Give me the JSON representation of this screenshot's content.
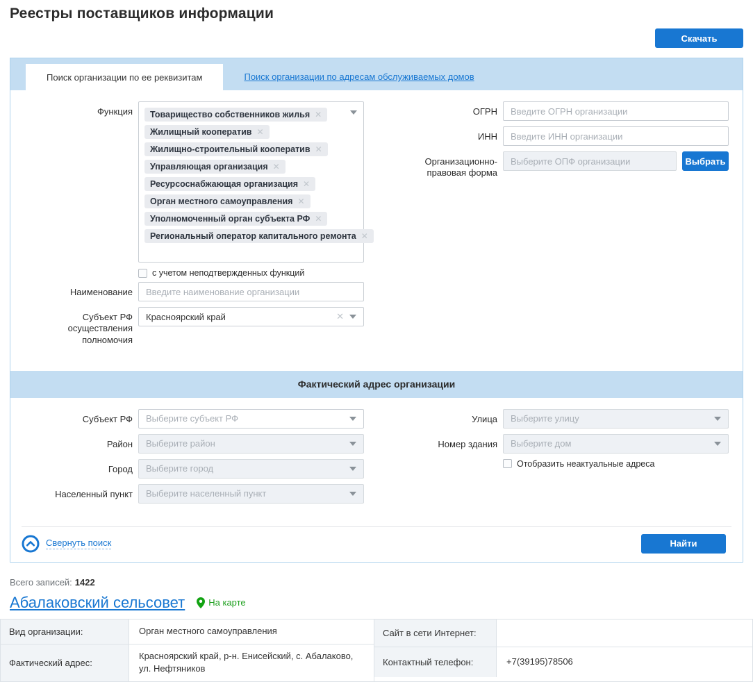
{
  "page": {
    "title": "Реестры поставщиков информации",
    "download_button": "Скачать"
  },
  "tabs": [
    {
      "label": "Поиск организации по ее реквизитам",
      "active": true
    },
    {
      "label": "Поиск организации по адресам обслуживаемых домов",
      "active": false
    }
  ],
  "search_form": {
    "function": {
      "label": "Функция",
      "tags": [
        "Товарищество собственников жилья",
        "Жилищный кооператив",
        "Жилищно-строительный кооператив",
        "Управляющая организация",
        "Ресурсоснабжающая организация",
        "Орган местного самоуправления",
        "Уполномоченный орган субъекта РФ",
        "Региональный оператор капитального ремонта"
      ]
    },
    "unconfirmed_checkbox": "с учетом неподтвержденных функций",
    "name": {
      "label": "Наименование",
      "placeholder": "Введите наименование организации"
    },
    "subject_rf_authority": {
      "label": "Субъект РФ осуществления полномочия",
      "value": "Красноярский край"
    },
    "ogrn": {
      "label": "ОГРН",
      "placeholder": "Введите ОГРН организации"
    },
    "inn": {
      "label": "ИНН",
      "placeholder": "Введите ИНН организации"
    },
    "opf": {
      "label": "Организационно-правовая форма",
      "placeholder": "Выберите ОПФ организации",
      "button": "Выбрать"
    }
  },
  "address_section": {
    "title": "Фактический адрес организации",
    "subject": {
      "label": "Субъект РФ",
      "placeholder": "Выберите субъект РФ"
    },
    "district": {
      "label": "Район",
      "placeholder": "Выберите район"
    },
    "city": {
      "label": "Город",
      "placeholder": "Выберите город"
    },
    "settlement": {
      "label": "Населенный пункт",
      "placeholder": "Выберите населенный пункт"
    },
    "street": {
      "label": "Улица",
      "placeholder": "Выберите улицу"
    },
    "house": {
      "label": "Номер здания",
      "placeholder": "Выберите дом"
    },
    "inactive_checkbox": "Отобразить неактуальные адреса"
  },
  "footer": {
    "collapse_link": "Свернуть поиск",
    "find_button": "Найти"
  },
  "results": {
    "total_label": "Всего записей:",
    "total_value": "1422",
    "org_name": "Абалаковский сельсовет",
    "map_link": "На карте",
    "details": {
      "type_label": "Вид организации:",
      "type_value": "Орган местного самоуправления",
      "site_label": "Сайт в сети Интернет:",
      "site_value": "",
      "address_label": "Фактический адрес:",
      "address_value": "Красноярский край, р-н. Енисейский, с. Абалаково, ул. Нефтяников",
      "phone_label": "Контактный телефон:",
      "phone_value": "+7(39195)78506"
    }
  },
  "colors": {
    "accent_blue": "#1877d2",
    "band_blue": "#c3ddf2",
    "map_green": "#21a121"
  }
}
